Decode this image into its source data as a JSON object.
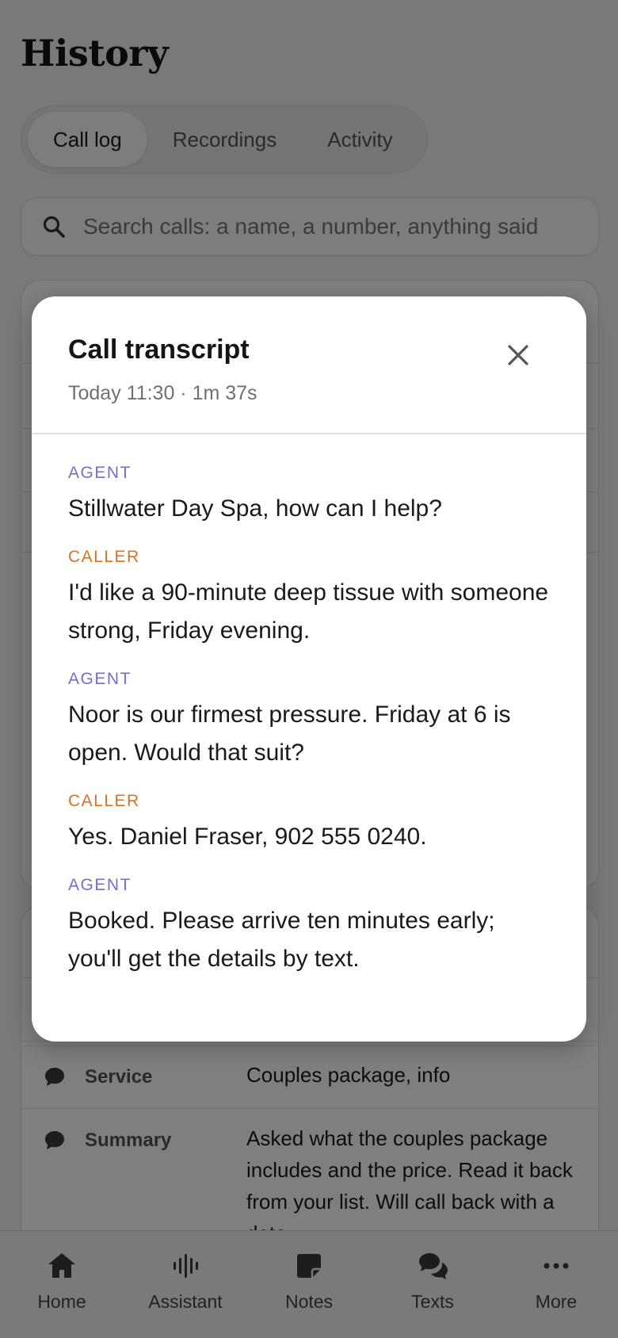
{
  "page": {
    "title": "History",
    "tabs": [
      {
        "label": "Call log",
        "active": true
      },
      {
        "label": "Recordings",
        "active": false
      },
      {
        "label": "Activity",
        "active": false
      }
    ],
    "search": {
      "placeholder": "Search calls: a name, a number, anything said"
    }
  },
  "call_details": [
    {
      "icon": "chat-bubble-icon",
      "label": "Service",
      "value": "Couples package, info"
    },
    {
      "icon": "chat-bubble-icon",
      "label": "Summary",
      "value": "Asked what the couples package includes and the price. Read it back from your list. Will call back with a date."
    }
  ],
  "bottom_nav": [
    {
      "icon": "home-icon",
      "label": "Home"
    },
    {
      "icon": "waveform-icon",
      "label": "Assistant"
    },
    {
      "icon": "note-icon",
      "label": "Notes"
    },
    {
      "icon": "chat-bubbles-icon",
      "label": "Texts"
    },
    {
      "icon": "more-dots-icon",
      "label": "More"
    }
  ],
  "modal": {
    "title": "Call transcript",
    "subtitle": "Today 11:30 · 1m 37s",
    "close_icon": "close-icon",
    "colors": {
      "agent": "#7a6cc8",
      "caller": "#d4742a"
    },
    "transcript": [
      {
        "speaker": "AGENT",
        "role": "agent",
        "text": "Stillwater Day Spa, how can I help?"
      },
      {
        "speaker": "CALLER",
        "role": "caller",
        "text": "I'd like a 90-minute deep tissue with someone strong, Friday evening."
      },
      {
        "speaker": "AGENT",
        "role": "agent",
        "text": "Noor is our firmest pressure. Friday at 6 is open. Would that suit?"
      },
      {
        "speaker": "CALLER",
        "role": "caller",
        "text": "Yes. Daniel Fraser, 902 555 0240."
      },
      {
        "speaker": "AGENT",
        "role": "agent",
        "text": "Booked. Please arrive ten minutes early; you'll get the details by text."
      }
    ]
  }
}
